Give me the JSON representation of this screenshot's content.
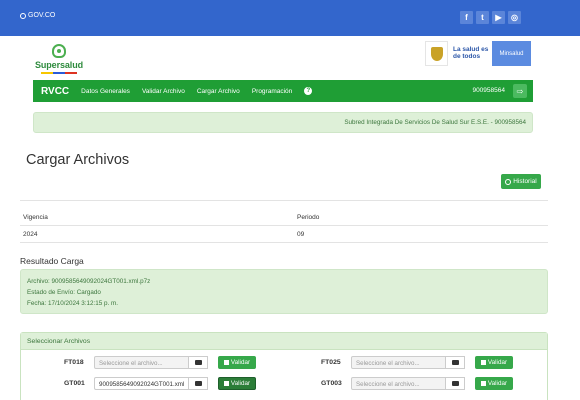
{
  "gov_bar": {
    "logo_text": "GOV.CO",
    "social_icons": [
      "f",
      "t",
      "▶",
      "◎"
    ]
  },
  "brand": {
    "name": "Supersalud"
  },
  "ministry": {
    "slogan": "La salud es de todos",
    "name": "Minsalud"
  },
  "nav": {
    "brand": "RVCC",
    "items": [
      "Datos Generales",
      "Validar Archivo",
      "Cargar Archivo",
      "Programación"
    ],
    "help_icon": "?",
    "user_id": "900958564",
    "logout_icon": "⇨"
  },
  "entity_banner": "Subred Integrada De Servicios De Salud Sur E.S.E. - 900958564",
  "page_title": "Cargar Archivos",
  "historial_label": "Historial",
  "summary": {
    "headers": [
      "Vigencia",
      "Periodo"
    ],
    "values": [
      "2024",
      "09"
    ]
  },
  "result": {
    "title": "Resultado Carga",
    "lines": [
      "Archivo: 9009585649092024GT001.xml.p7z",
      "Estado de Envío: Cargado",
      "Fecha: 17/10/2024 3:12:15 p. m."
    ]
  },
  "select_panel": {
    "title": "Seleccionar Archivos",
    "placeholder": "Seleccione el archivo...",
    "validar_label": "Validar",
    "files": [
      {
        "label": "FT018",
        "value": ""
      },
      {
        "label": "FT025",
        "value": ""
      },
      {
        "label": "GT001",
        "value": "9009585649092024GT001.xml"
      },
      {
        "label": "GT003",
        "value": ""
      }
    ]
  }
}
